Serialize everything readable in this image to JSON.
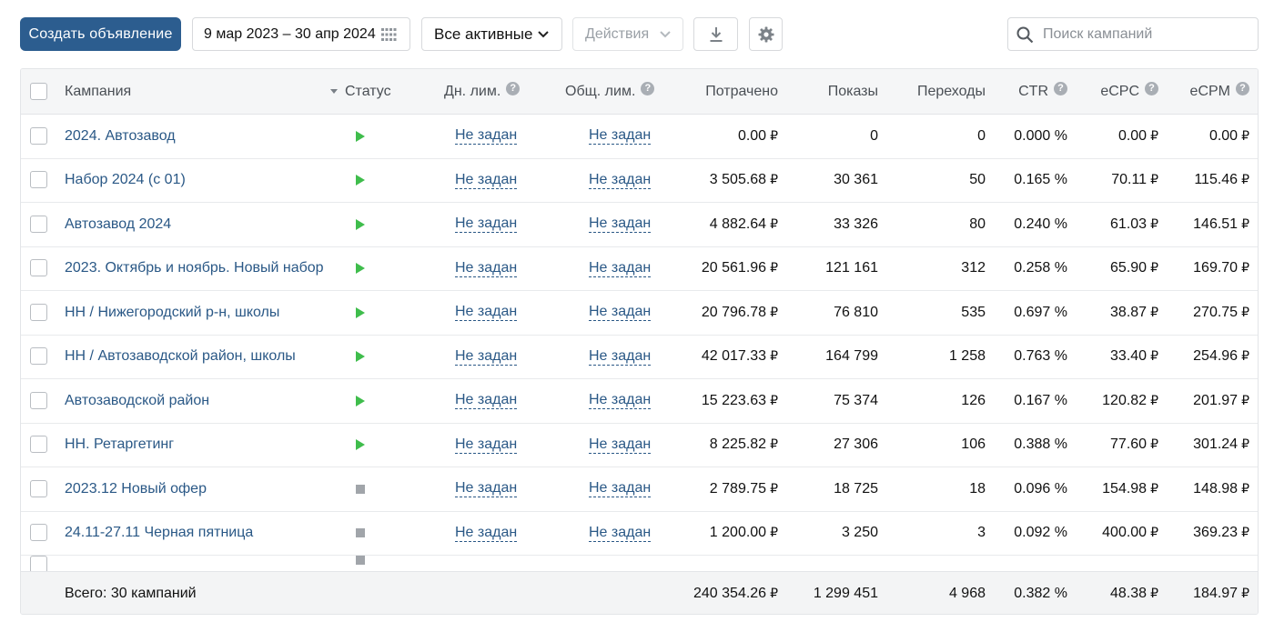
{
  "toolbar": {
    "create_label": "Создать объявление",
    "date_range": "9 мар 2023 – 30 апр 2024",
    "filter_label": "Все активные",
    "actions_label": "Действия",
    "search_placeholder": "Поиск кампаний",
    "icons": [
      "calendar-grid-icon",
      "chevron-down-icon",
      "download-icon",
      "gear-icon",
      "search-icon"
    ]
  },
  "headers": {
    "campaign": "Кампания",
    "status": "Статус",
    "day_limit": "Дн. лим.",
    "total_limit": "Общ. лим.",
    "spent": "Потрачено",
    "impressions": "Показы",
    "clicks": "Переходы",
    "ctr": "CTR",
    "ecpc": "eCPC",
    "ecpm": "eCPM",
    "help_glyph": "?"
  },
  "currency": "₽",
  "rows": [
    {
      "name": "2024. Автозавод",
      "status": "active",
      "day_limit": "Не задан",
      "total_limit": "Не задан",
      "spent": "0.00",
      "impressions": "0",
      "clicks": "0",
      "ctr": "0.000 %",
      "ecpc": "0.00",
      "ecpm": "0.00"
    },
    {
      "name": "Набор 2024 (с 01)",
      "status": "active",
      "day_limit": "Не задан",
      "total_limit": "Не задан",
      "spent": "3 505.68",
      "impressions": "30 361",
      "clicks": "50",
      "ctr": "0.165 %",
      "ecpc": "70.11",
      "ecpm": "115.46"
    },
    {
      "name": "Автозавод 2024",
      "status": "active",
      "day_limit": "Не задан",
      "total_limit": "Не задан",
      "spent": "4 882.64",
      "impressions": "33 326",
      "clicks": "80",
      "ctr": "0.240 %",
      "ecpc": "61.03",
      "ecpm": "146.51"
    },
    {
      "name": "2023. Октябрь и ноябрь. Новый набор",
      "status": "active",
      "day_limit": "Не задан",
      "total_limit": "Не задан",
      "spent": "20 561.96",
      "impressions": "121 161",
      "clicks": "312",
      "ctr": "0.258 %",
      "ecpc": "65.90",
      "ecpm": "169.70"
    },
    {
      "name": "НН / Нижегородский р-н, школы",
      "status": "active",
      "day_limit": "Не задан",
      "total_limit": "Не задан",
      "spent": "20 796.78",
      "impressions": "76 810",
      "clicks": "535",
      "ctr": "0.697 %",
      "ecpc": "38.87",
      "ecpm": "270.75"
    },
    {
      "name": "НН / Автозаводской район, школы",
      "status": "active",
      "day_limit": "Не задан",
      "total_limit": "Не задан",
      "spent": "42 017.33",
      "impressions": "164 799",
      "clicks": "1 258",
      "ctr": "0.763 %",
      "ecpc": "33.40",
      "ecpm": "254.96"
    },
    {
      "name": "Автозаводской район",
      "status": "active",
      "day_limit": "Не задан",
      "total_limit": "Не задан",
      "spent": "15 223.63",
      "impressions": "75 374",
      "clicks": "126",
      "ctr": "0.167 %",
      "ecpc": "120.82",
      "ecpm": "201.97"
    },
    {
      "name": "НН. Ретаргетинг",
      "status": "active",
      "day_limit": "Не задан",
      "total_limit": "Не задан",
      "spent": "8 225.82",
      "impressions": "27 306",
      "clicks": "106",
      "ctr": "0.388 %",
      "ecpc": "77.60",
      "ecpm": "301.24"
    },
    {
      "name": "2023.12 Новый офер",
      "status": "stopped",
      "day_limit": "Не задан",
      "total_limit": "Не задан",
      "spent": "2 789.75",
      "impressions": "18 725",
      "clicks": "18",
      "ctr": "0.096 %",
      "ecpc": "154.98",
      "ecpm": "148.98"
    },
    {
      "name": "24.11-27.11 Черная пятница",
      "status": "stopped",
      "day_limit": "Не задан",
      "total_limit": "Не задан",
      "spent": "1 200.00",
      "impressions": "3 250",
      "clicks": "3",
      "ctr": "0.092 %",
      "ecpc": "400.00",
      "ecpm": "369.23"
    }
  ],
  "partial_row_status": "stopped",
  "footer": {
    "label": "Всего: 30 кампаний",
    "spent": "240 354.26",
    "impressions": "1 299 451",
    "clicks": "4 968",
    "ctr": "0.382 %",
    "ecpc": "48.38",
    "ecpm": "184.97"
  },
  "colors": {
    "primary": "#2c5d8f",
    "link": "#2a5886",
    "active_status": "#3fbd4c",
    "stopped_status": "#a1a5aa"
  }
}
